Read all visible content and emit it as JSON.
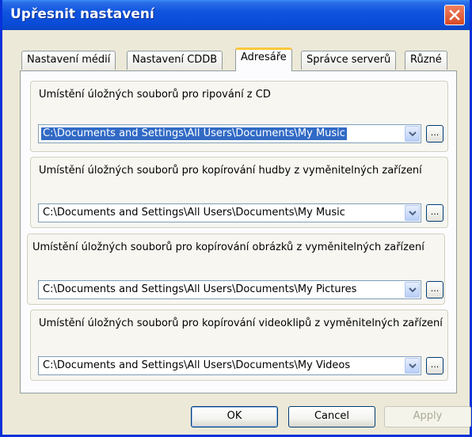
{
  "window": {
    "title": "Upřesnit nastavení"
  },
  "tabs": [
    {
      "label": "Nastavení médií",
      "active": false
    },
    {
      "label": "Nastavení CDDB",
      "active": false
    },
    {
      "label": "Adresáře",
      "active": true
    },
    {
      "label": "Správce serverů",
      "active": false
    },
    {
      "label": "Různé",
      "active": false
    }
  ],
  "groups": [
    {
      "label": "Umístění úložných souborů pro ripování z CD",
      "path": "C:\\Documents and Settings\\All Users\\Documents\\My Music",
      "browse": "..."
    },
    {
      "label": "Umístění úložných souborů pro kopírování hudby z vyměnitelných zařízení",
      "path": "C:\\Documents and Settings\\All Users\\Documents\\My Music",
      "browse": "..."
    },
    {
      "label": "Umístění úložných souborů pro kopírování obrázků z vyměnitelných zařízení",
      "path": "C:\\Documents and Settings\\All Users\\Documents\\My Pictures",
      "browse": "..."
    },
    {
      "label": "Umístění úložných souborů pro kopírování videoklipů z vyměnitelných zařízení",
      "path": "C:\\Documents and Settings\\All Users\\Documents\\My Videos",
      "browse": "..."
    }
  ],
  "buttons": {
    "ok": "OK",
    "cancel": "Cancel",
    "apply": "Apply"
  },
  "colors": {
    "titlebar": "#0a4cd8",
    "close": "#d64a25",
    "active_tab_highlight": "#ffc83c",
    "selection": "#316ac5"
  }
}
